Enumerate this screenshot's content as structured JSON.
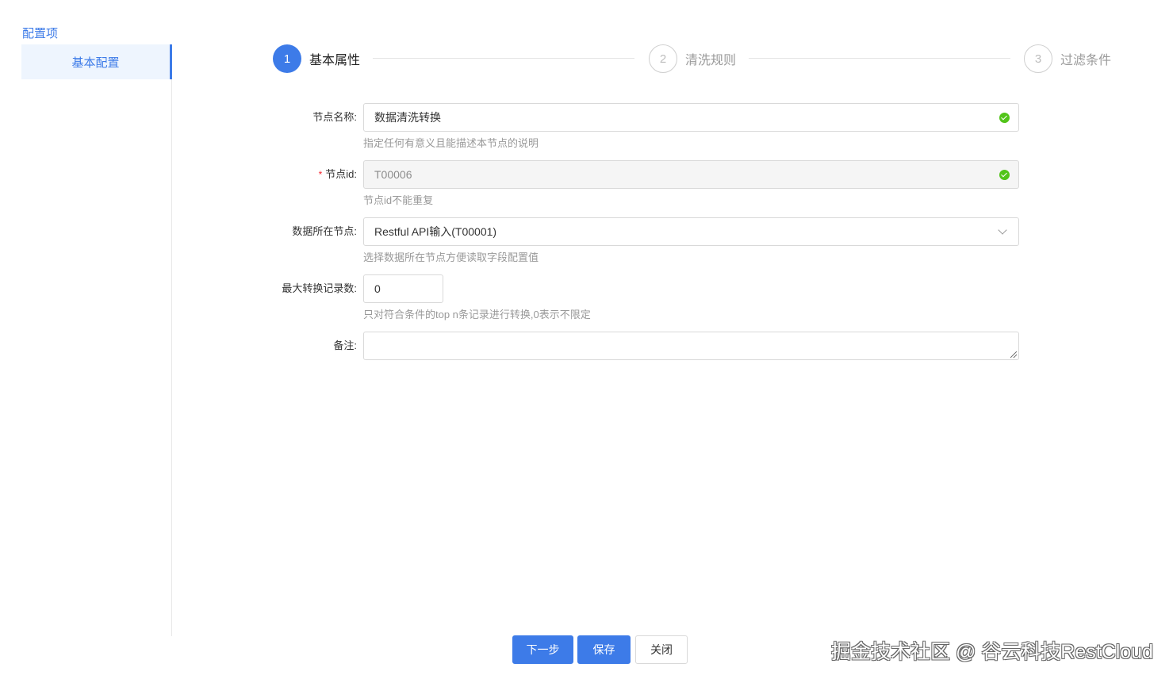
{
  "sidebar": {
    "title": "配置项",
    "items": [
      {
        "label": "基本配置",
        "active": true
      }
    ]
  },
  "steps": [
    {
      "number": "1",
      "label": "基本属性",
      "status": "active"
    },
    {
      "number": "2",
      "label": "清洗规则",
      "status": "wait"
    },
    {
      "number": "3",
      "label": "过滤条件",
      "status": "wait"
    }
  ],
  "form": {
    "node_name": {
      "label": "节点名称:",
      "value": "数据清洗转换",
      "hint": "指定任何有意义且能描述本节点的说明",
      "status": "valid"
    },
    "node_id": {
      "required_mark": "*",
      "label": "节点id:",
      "value": "T00006",
      "hint": "节点id不能重复",
      "status": "valid",
      "disabled": true
    },
    "data_node": {
      "label": "数据所在节点:",
      "value": "Restful API输入(T00001)",
      "hint": "选择数据所在节点方便读取字段配置值"
    },
    "max_records": {
      "label": "最大转换记录数:",
      "value": "0",
      "hint": "只对符合条件的top n条记录进行转换,0表示不限定"
    },
    "remark": {
      "label": "备注:",
      "value": ""
    }
  },
  "buttons": {
    "next": "下一步",
    "save": "保存",
    "close": "关闭"
  },
  "watermark": "掘金技术社区 @ 谷云科技RestCloud",
  "colors": {
    "primary": "#3d7be8",
    "success": "#52c41a",
    "required": "#f5222d"
  }
}
